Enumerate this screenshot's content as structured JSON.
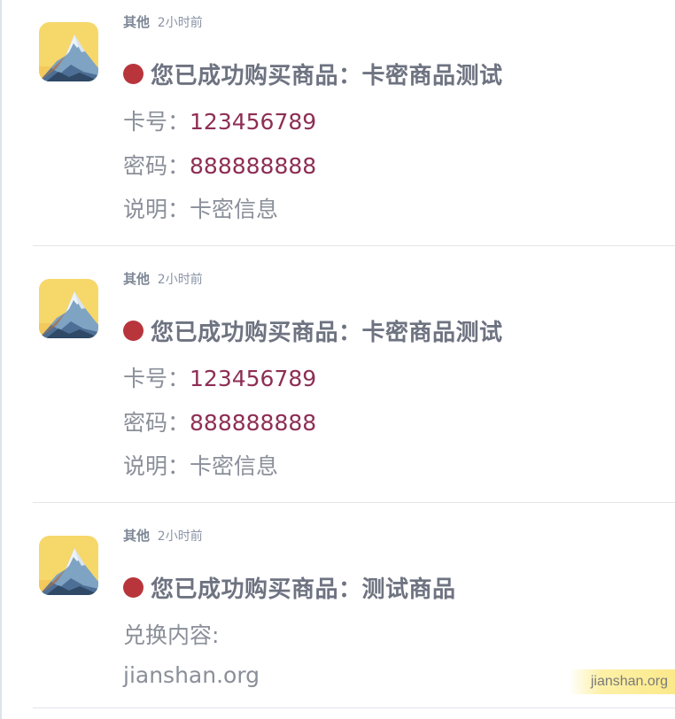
{
  "messages": [
    {
      "sender": "其他",
      "time": "2小时前",
      "icon": "mountain-app-icon",
      "title": "您已成功购买商品：卡密商品测试",
      "lines": [
        {
          "label": "卡号：",
          "value": "123456789"
        },
        {
          "label": "密码：",
          "value": "888888888"
        },
        {
          "label": "说明：",
          "value": "卡密信息"
        }
      ]
    },
    {
      "sender": "其他",
      "time": "2小时前",
      "icon": "mountain-app-icon",
      "title": "您已成功购买商品：卡密商品测试",
      "lines": [
        {
          "label": "卡号：",
          "value": "123456789"
        },
        {
          "label": "密码：",
          "value": "888888888"
        },
        {
          "label": "说明：",
          "value": "卡密信息"
        }
      ]
    },
    {
      "sender": "其他",
      "time": "2小时前",
      "icon": "mountain-app-icon",
      "title": "您已成功购买商品：测试商品",
      "lines": [
        {
          "label": "兑换内容:",
          "value": ""
        },
        {
          "label": "jianshan.org",
          "value": ""
        }
      ]
    }
  ],
  "watermark": "jianshan.org",
  "colors": {
    "status_dot": "#b8353c",
    "accent_value": "#8e2e55",
    "title_text": "#6e7381",
    "body_text": "#8a8f99",
    "avatar_bg": "#f6d76a"
  }
}
